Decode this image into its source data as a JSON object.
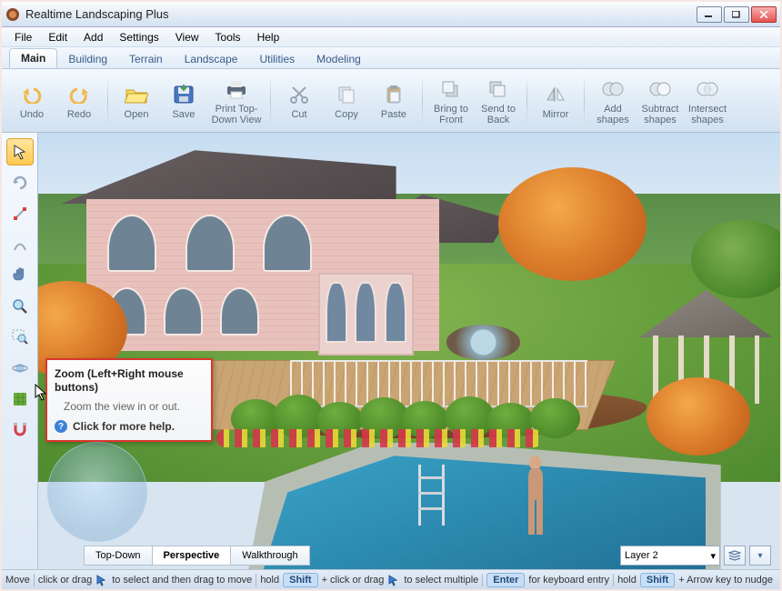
{
  "window": {
    "title": "Realtime Landscaping Plus"
  },
  "menu": {
    "file": "File",
    "edit": "Edit",
    "add": "Add",
    "settings": "Settings",
    "view": "View",
    "tools": "Tools",
    "help": "Help"
  },
  "tabs": {
    "main": "Main",
    "building": "Building",
    "terrain": "Terrain",
    "landscape": "Landscape",
    "utilities": "Utilities",
    "modeling": "Modeling"
  },
  "ribbon": {
    "undo": "Undo",
    "redo": "Redo",
    "open": "Open",
    "save": "Save",
    "print": "Print Top-Down View",
    "cut": "Cut",
    "copy": "Copy",
    "paste": "Paste",
    "bringfront": "Bring to Front",
    "sendback": "Send to Back",
    "mirror": "Mirror",
    "addshapes": "Add shapes",
    "subshapes": "Subtract shapes",
    "intshapes": "Intersect shapes"
  },
  "tooltip": {
    "title": "Zoom (Left+Right mouse buttons)",
    "desc": "Zoom the view in or out.",
    "help": "Click for more help."
  },
  "viewtabs": {
    "topdown": "Top-Down",
    "perspective": "Perspective",
    "walkthrough": "Walkthrough"
  },
  "layer": {
    "selected": "Layer 2"
  },
  "status": {
    "move": "Move",
    "s1a": "click or drag",
    "s1b": "to select and then drag to move",
    "hold": "hold",
    "shift": "Shift",
    "s2a": "+ click or drag",
    "s2b": "to select multiple",
    "enter": "Enter",
    "s3": "for keyboard entry",
    "s4": "+ Arrow key to nudge"
  }
}
